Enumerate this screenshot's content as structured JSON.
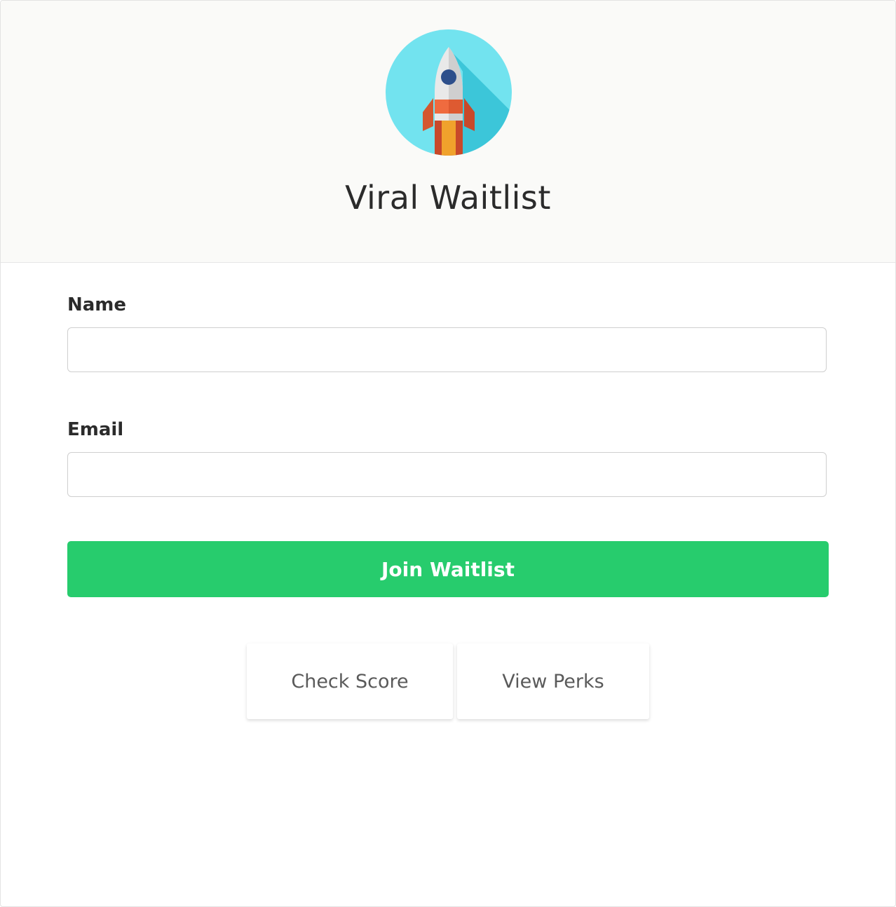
{
  "header": {
    "title": "Viral Waitlist",
    "logo_icon": "rocket-icon",
    "colors": {
      "background": "#fafaf8",
      "logo_circle": "#72e3ef",
      "logo_shadow": "#3cc6d9"
    }
  },
  "form": {
    "name_label": "Name",
    "name_value": "",
    "email_label": "Email",
    "email_value": "",
    "join_label": "Join Waitlist",
    "join_color": "#27cc6d"
  },
  "actions": {
    "check_score_label": "Check Score",
    "view_perks_label": "View Perks"
  }
}
